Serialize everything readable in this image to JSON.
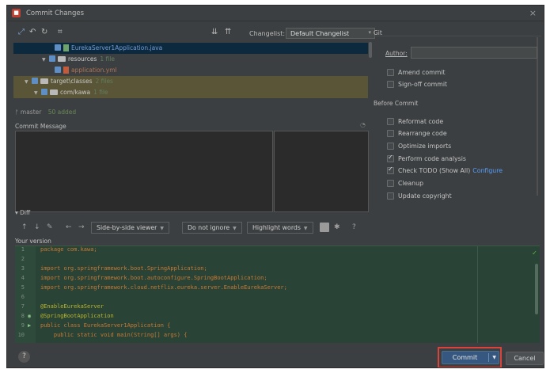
{
  "window": {
    "title": "Commit Changes",
    "close": "×"
  },
  "toolbar": {
    "icons": [
      "arrow-icon",
      "undo-icon",
      "refresh-icon",
      "group-icon",
      "expand-icon",
      "collapse-icon"
    ],
    "changelist_label": "Changelist:",
    "changelist_value": "Default Changelist"
  },
  "tree": [
    {
      "label": "EurekaServer1Application.java",
      "kind": "java",
      "selected": true
    },
    {
      "label": "resources",
      "count": "1 file",
      "kind": "folder"
    },
    {
      "label": "application.yml",
      "kind": "yml"
    },
    {
      "label": "target\\classes",
      "count": "2 files",
      "kind": "folder",
      "highlight": true
    },
    {
      "label": "com/kawa",
      "count": "1 file",
      "kind": "folder",
      "highlight": true
    }
  ],
  "branch": {
    "name": "master",
    "added": "50 added"
  },
  "commit_message": {
    "label": "Commit Message"
  },
  "git": {
    "label": "Git",
    "author_label": "Author:",
    "author_value": "",
    "options": [
      {
        "label": "Amend commit",
        "checked": false
      },
      {
        "label": "Sign-off commit",
        "checked": false
      }
    ]
  },
  "before_commit": {
    "label": "Before Commit",
    "options": [
      {
        "label": "Reformat code",
        "checked": false
      },
      {
        "label": "Rearrange code",
        "checked": false
      },
      {
        "label": "Optimize imports",
        "checked": false
      },
      {
        "label": "Perform code analysis",
        "checked": true
      },
      {
        "label": "Check TODO (Show All)",
        "checked": true,
        "link": "Configure"
      },
      {
        "label": "Cleanup",
        "checked": false
      },
      {
        "label": "Update copyright",
        "checked": false
      }
    ]
  },
  "diff": {
    "label": "Diff",
    "viewer": "Side-by-side viewer",
    "ignore": "Do not ignore",
    "highlight": "Highlight words",
    "help": "?",
    "your_version": "Your version"
  },
  "code": [
    {
      "n": "1",
      "text": "package com.kawa;"
    },
    {
      "n": "2",
      "text": ""
    },
    {
      "n": "3",
      "text": "import org.springframework.boot.SpringApplication;"
    },
    {
      "n": "4",
      "text": "import org.springframework.boot.autoconfigure.SpringBootApplication;"
    },
    {
      "n": "5",
      "text": "import org.springframework.cloud.netflix.eureka.server.EnableEurekaServer;"
    },
    {
      "n": "6",
      "text": ""
    },
    {
      "n": "7",
      "text": "@EnableEurekaServer"
    },
    {
      "n": "8",
      "text": "@SpringBootApplication"
    },
    {
      "n": "9",
      "text": "public class EurekaServer1Application {"
    },
    {
      "n": "10",
      "text": "    public static void main(String[] args) {"
    }
  ],
  "buttons": {
    "commit": "Commit",
    "cancel": "Cancel",
    "help": "?"
  }
}
